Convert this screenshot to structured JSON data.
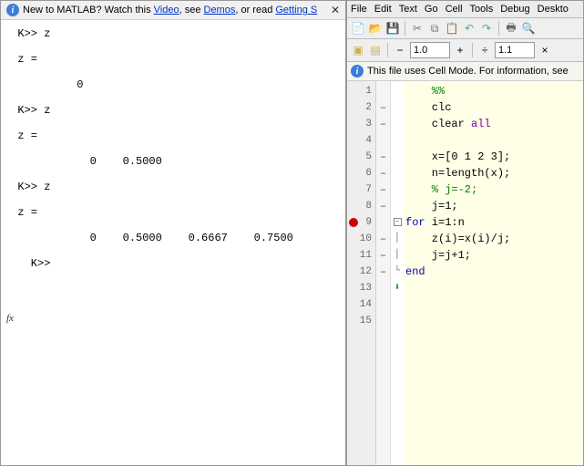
{
  "left": {
    "info_prefix": "New to MATLAB? Watch this ",
    "video": "Video",
    "sep1": ", see ",
    "demos": "Demos",
    "sep2": ", or read ",
    "getting": "Getting S",
    "cmd_text": "  K>> z\n\n  z =\n\n           0\n\n  K>> z\n\n  z =\n\n             0    0.5000\n\n  K>> z\n\n  z =\n\n             0    0.5000    0.6667    0.7500\n\n    K>> ",
    "fx": "fx"
  },
  "right": {
    "menu": {
      "file": "File",
      "edit": "Edit",
      "text": "Text",
      "go": "Go",
      "cell": "Cell",
      "tools": "Tools",
      "debug": "Debug",
      "desktop": "Deskto"
    },
    "zoom1": "1.0",
    "zoom2": "1.1",
    "cell_info": "This file uses Cell Mode. For information, see",
    "gutter": [
      "1",
      "2",
      "3",
      "4",
      "5",
      "6",
      "7",
      "8",
      "9",
      "10",
      "11",
      "12",
      "13",
      "14",
      "15"
    ],
    "marks": [
      "",
      "–",
      "–",
      "",
      "–",
      "–",
      "–",
      "–",
      "",
      "–",
      "–",
      "–",
      "",
      "",
      ""
    ],
    "code": {
      "l1": "    %%",
      "l2": "    clc",
      "l3_a": "    clear ",
      "l3_b": "all",
      "l4": "",
      "l5": "    x=[0 1 2 3];",
      "l6": "    n=length(x);",
      "l7": "    % j=-2;",
      "l8": "    j=1;",
      "l9_a": "for",
      "l9_b": " i=1:n",
      "l10": "    z(i)=x(i)/j;",
      "l11": "    j=j+1;",
      "l12": "end",
      "l13": "",
      "l14": "",
      "l15": ""
    }
  }
}
